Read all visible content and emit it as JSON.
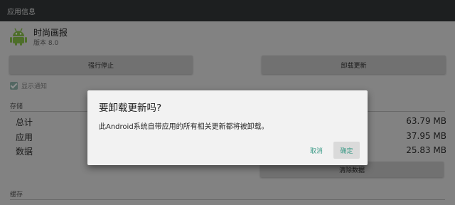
{
  "window": {
    "title": "应用信息"
  },
  "app": {
    "name": "时尚画报",
    "version": "版本 8.0",
    "icon": "android-robot-icon",
    "icon_color": "#7fb244"
  },
  "buttons": {
    "force_stop": "强行停止",
    "uninstall_updates": "卸载更新",
    "clear_data": "清除数据"
  },
  "notifications": {
    "label": "显示通知",
    "checked": true
  },
  "storage": {
    "section_title": "存储",
    "rows": [
      {
        "label": "总计",
        "value": "63.79 MB"
      },
      {
        "label": "应用",
        "value": "37.95 MB"
      },
      {
        "label": "数据",
        "value": "25.83 MB"
      }
    ]
  },
  "cache": {
    "section_title": "缓存"
  },
  "dialog": {
    "title": "要卸载更新吗?",
    "message": "此Android系统自带应用的所有相关更新都将被卸载。",
    "cancel_label": "取消",
    "ok_label": "确定",
    "accent": "#3a9a86"
  }
}
